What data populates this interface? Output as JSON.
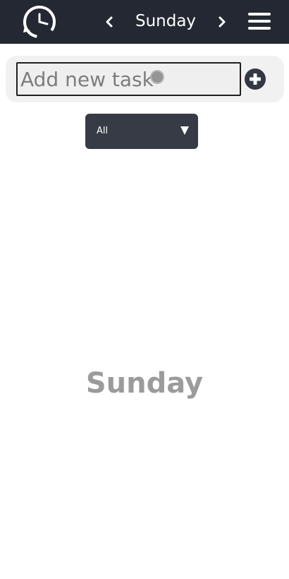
{
  "header": {
    "day": "Sunday",
    "logo_icon": "clock-sync-icon",
    "prev_icon": "chevron-left-icon",
    "next_icon": "chevron-right-icon",
    "menu_icon": "hamburger-menu-icon",
    "background_color": "#232833"
  },
  "add_task": {
    "placeholder": "Add new task",
    "value": "",
    "add_icon": "plus-circle-icon"
  },
  "filter": {
    "selected": "All",
    "caret_icon": "caret-down-icon"
  },
  "empty_state": {
    "text": "Sunday"
  }
}
